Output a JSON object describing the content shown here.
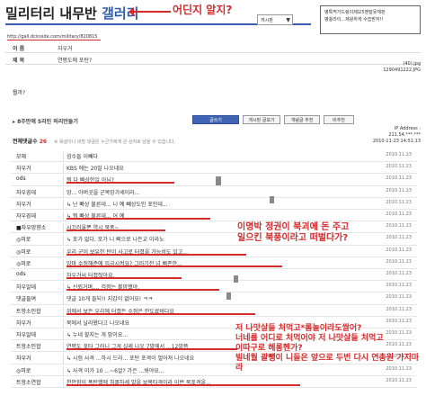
{
  "header": {
    "title_part1": "밀리터리 내무반",
    "title_part2": "갤러리",
    "annotation": "어딘지 알지?",
    "select_value": "게시판",
    "url": "http://gall.dcinside.com/military/820815"
  },
  "corner_box": {
    "lines": [
      "병특먹거드링이제모5맨잘못재판",
      "병충라이...제왕하게 수습받자!!"
    ]
  },
  "post": {
    "name_label": "이 름",
    "name_value": "자우거",
    "subject_label": "제 목",
    "subject_value": "연평도에 포탄?",
    "files": [
      "(40).jpg",
      "1290491222.JPG"
    ],
    "body": "뭘까?",
    "ip_label": "IP Address : 211.54.***.***",
    "datetime": "2010-11-23 14:51:13"
  },
  "section": {
    "label": "8주만에 5리인 허리만들기",
    "buttons": [
      "글쓰기",
      "게시판 글보기",
      "개념글 추천",
      "비추천"
    ]
  },
  "comments": {
    "heading": "전체댓글수",
    "count": "26",
    "hint": "※ 욕설이나 비방 댓글은 누군가에게 큰 상처로 남을 수 있습니다.",
    "rows": [
      {
        "nick": "모해",
        "text": "섬수들 이빼다"
      },
      {
        "nick": "자우거",
        "text": "KBS 에는 20발 나오네요"
      },
      {
        "nick": "ods",
        "text": "뭐 다 삐상한일 아님?"
      },
      {
        "nick": "자우꽁데",
        "text": "앙... 아버곳을 군복망가세이라..."
      },
      {
        "nick": "자우거",
        "text": "↳ 난 빠상 불른데... 니 예 빼상도인 포인데..."
      },
      {
        "nick": "자우꽁데",
        "text": "↳ 뭐 빠상 불른데... 어 예"
      },
      {
        "nick": "■자우망향소",
        "text": "시끄러울뿐 역시 북풍~"
      },
      {
        "nick": "◎미로",
        "text": "↳ 포가 없다. 포가 니 삐으로 나든교 이라노"
      },
      {
        "nick": "◎미로",
        "text": "우리 군이 보유한 탄이 사고로 터졌을 가능성도 있고..."
      },
      {
        "nick": "◎미로",
        "text": "앙마 수정해준에 입금시켜요? 그러기전 넘 삐존한..."
      },
      {
        "nick": "ods",
        "text": "자우거씨 터졌잖아요."
      },
      {
        "nick": "자우알데",
        "text": "↳ 신뢰거며.... 걱정는 볼망했야."
      },
      {
        "nick": "댓글들여",
        "text": "댓글 10개 들되!! 지갑이 없어요! ㅋㅋ"
      },
      {
        "nick": "트항소인합",
        "text": "위에서 보든 우리에 터졌든 수정은 안도료바다요"
      },
      {
        "nick": "자우거",
        "text": "북에서 날라왔다고 나오네요"
      },
      {
        "nick": "자우알데",
        "text": "↳ 누네 할지는 게 맘이요..."
      },
      {
        "nick": "트항소인합",
        "text": "연평도 포타 그러니 그게 실제 나오 7발에서 ...12발쯤"
      },
      {
        "nick": "자우거",
        "text": "↳ 시험 사격 ...하시 드라... 포탄 포격이 벌어져 나오네요"
      },
      {
        "nick": "◎미로",
        "text": "↳ 사격 이가 10 ...~6알? 가은 ...봐야요..."
      },
      {
        "nick": "트항소연합",
        "text": "천안함이 폭탄했에 침몰하세 발을 보복타격이라 이번 북포격을..."
      }
    ],
    "dates": [
      "2010.11.23",
      "2010.11.23",
      "2010.11.23",
      "2010.11.23",
      "2010.11.23",
      "2010.11.23",
      "2010.11.23",
      "2010.11.23",
      "2010.11.23",
      "2010.11.23",
      "2010.11.23",
      "2010.11.23",
      "2010.11.23",
      "2010.11.23",
      "2010.11.23",
      "2010.11.23",
      "2010.11.23",
      "2010.11.23",
      "2010.11.23",
      "2010.11.23"
    ]
  },
  "annotations": {
    "middle": [
      "이명박 정권이 북괴에 돈 주고",
      "일으킨 북풍이라고 떠벌다가?"
    ],
    "bottom": [
      "저 나맛살들 처먹고*롬놀이라도쌀어?",
      "너네를 어디로 처먹어야 저 나맛살들 처먹고",
      "이따구로 헤롱헨가?",
      "빌네월 괄뺑이 니들은 앞으로 두번 다시 연총원 가지마라"
    ]
  },
  "colors": {
    "accent": "#d42b2b",
    "brand": "#2f5ea8"
  }
}
